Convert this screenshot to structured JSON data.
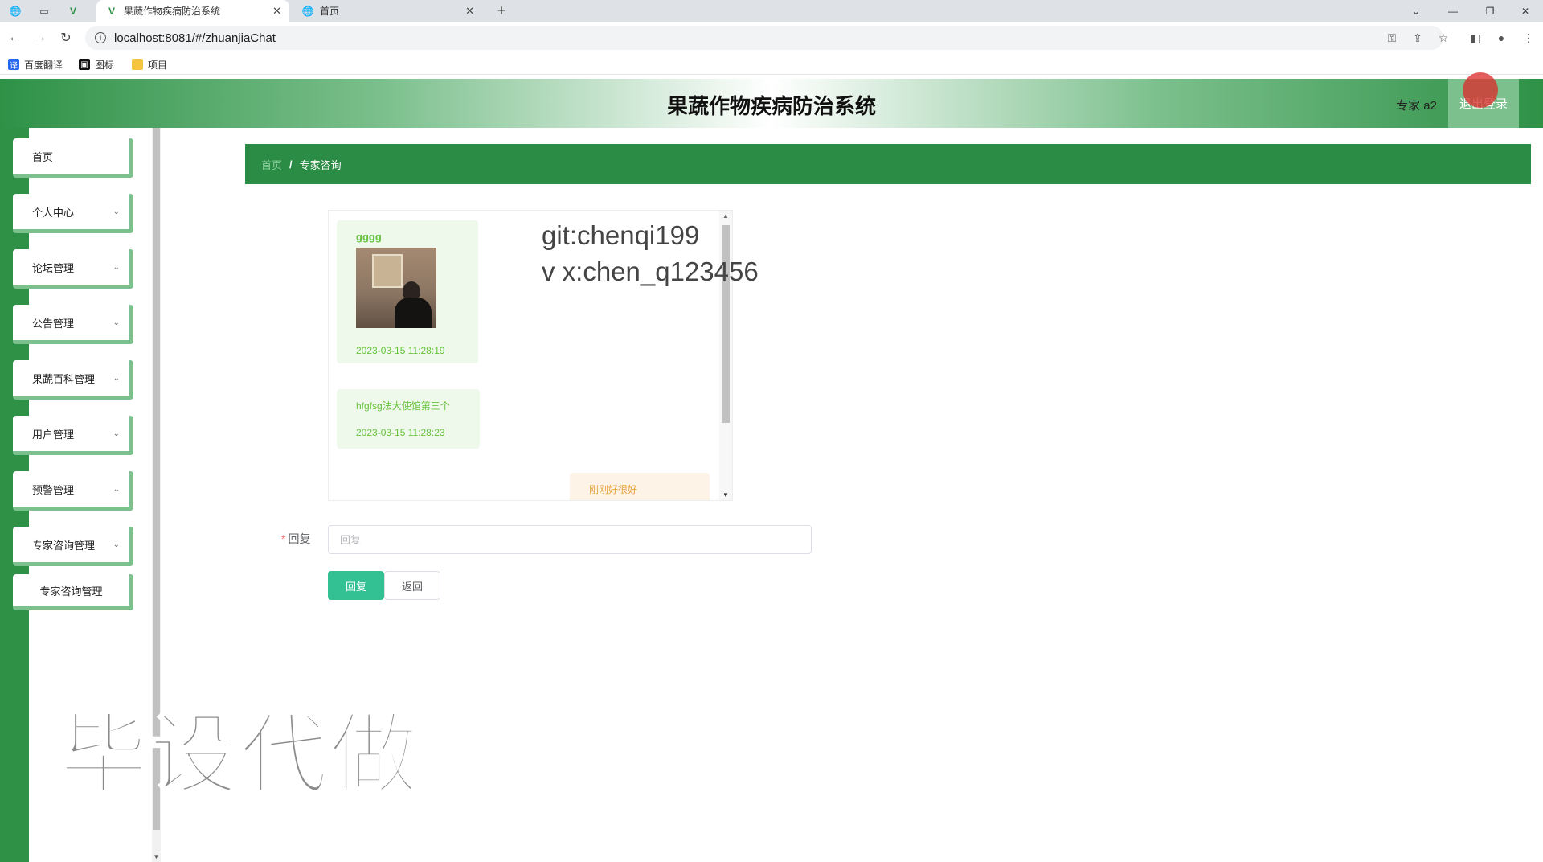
{
  "browser": {
    "tabs": [
      {
        "title": "",
        "icon": "globe-icon"
      },
      {
        "title": "",
        "icon": "blank-icon"
      },
      {
        "title": "",
        "icon": "vue-icon"
      },
      {
        "title": "果蔬作物疾病防治系统",
        "icon": "vue-icon",
        "active": true
      },
      {
        "title": "首页",
        "icon": "globe-icon"
      }
    ],
    "url": "localhost:8081/#/zhuanjiaChat",
    "bookmarks": [
      {
        "label": "百度翻译",
        "icon": "translate-icon",
        "color": "#2468f2"
      },
      {
        "label": "图标",
        "icon": "image-icon",
        "color": "#111111"
      },
      {
        "label": "项目",
        "icon": "folder-icon",
        "color": "#f5c542"
      }
    ]
  },
  "header": {
    "title": "果蔬作物疾病防治系统",
    "user": "专家 a2",
    "logout": "退出登录"
  },
  "sidebar": {
    "items": [
      {
        "label": "首页",
        "has_chevron": false
      },
      {
        "label": "个人中心",
        "has_chevron": true
      },
      {
        "label": "论坛管理",
        "has_chevron": true
      },
      {
        "label": "公告管理",
        "has_chevron": true
      },
      {
        "label": "果蔬百科管理",
        "has_chevron": true
      },
      {
        "label": "用户管理",
        "has_chevron": true
      },
      {
        "label": "预警管理",
        "has_chevron": true
      },
      {
        "label": "专家咨询管理",
        "has_chevron": true
      }
    ],
    "submenu": [
      "专家咨询管理"
    ]
  },
  "breadcrumb": {
    "home": "首页",
    "separator": "/",
    "current": "专家咨询"
  },
  "chat": {
    "messages": [
      {
        "name": "gggg",
        "has_image": true,
        "time": "2023-03-15 11:28:19",
        "side": "left"
      },
      {
        "text": "hfgfsg法大使馆第三个",
        "time": "2023-03-15 11:28:23",
        "side": "left"
      },
      {
        "text": "刚刚好很好",
        "side": "right"
      }
    ]
  },
  "overlay": {
    "line1": "git:chenqi199",
    "line2": "v x:chen_q123456"
  },
  "form": {
    "reply_label": "回复",
    "required_mark": "*",
    "reply_placeholder": "回复",
    "submit": "回复",
    "back": "返回"
  },
  "watermark": "毕设代做",
  "colors": {
    "primary_green": "#2e9146",
    "light_green": "#7cc08d",
    "button_teal": "#33c193",
    "message_green": "#67c23a",
    "message_orange": "#e6a23c"
  }
}
